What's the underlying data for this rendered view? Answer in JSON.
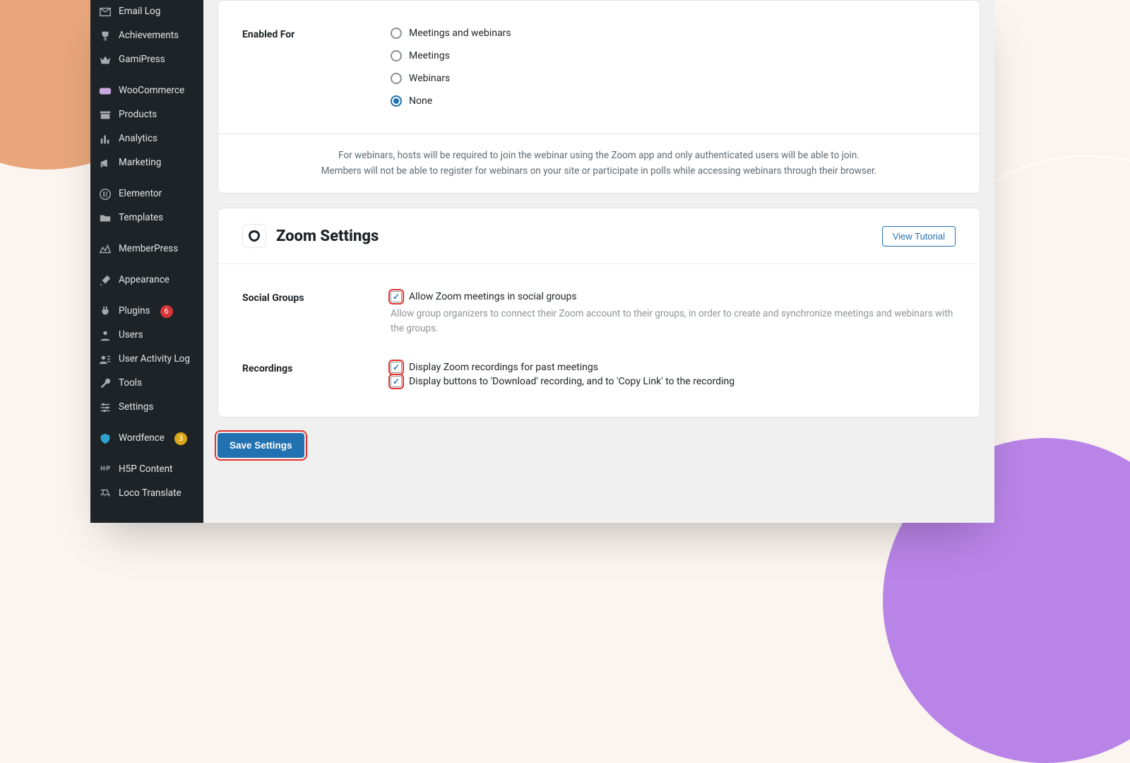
{
  "sidebar": {
    "items": [
      {
        "id": "email-log",
        "label": "Email Log"
      },
      {
        "id": "achievements",
        "label": "Achievements"
      },
      {
        "id": "gamipress",
        "label": "GamiPress"
      },
      {
        "id": "woocommerce",
        "label": "WooCommerce"
      },
      {
        "id": "products",
        "label": "Products"
      },
      {
        "id": "analytics",
        "label": "Analytics"
      },
      {
        "id": "marketing",
        "label": "Marketing"
      },
      {
        "id": "elementor",
        "label": "Elementor"
      },
      {
        "id": "templates",
        "label": "Templates"
      },
      {
        "id": "memberpress",
        "label": "MemberPress"
      },
      {
        "id": "appearance",
        "label": "Appearance"
      },
      {
        "id": "plugins",
        "label": "Plugins",
        "badge": "6",
        "badgeColor": "red"
      },
      {
        "id": "users",
        "label": "Users"
      },
      {
        "id": "user-activity-log",
        "label": "User Activity Log"
      },
      {
        "id": "tools",
        "label": "Tools"
      },
      {
        "id": "settings",
        "label": "Settings"
      },
      {
        "id": "wordfence",
        "label": "Wordfence",
        "badge": "3",
        "badgeColor": "orange"
      },
      {
        "id": "h5p-content",
        "label": "H5P Content"
      },
      {
        "id": "loco-translate",
        "label": "Loco Translate"
      }
    ]
  },
  "enabledFor": {
    "label": "Enabled For",
    "options": [
      {
        "id": "both",
        "label": "Meetings and webinars"
      },
      {
        "id": "meetings",
        "label": "Meetings"
      },
      {
        "id": "webinars",
        "label": "Webinars"
      },
      {
        "id": "none",
        "label": "None"
      }
    ],
    "selected": "none",
    "note": "For webinars, hosts will be required to join the webinar using the Zoom app and only authenticated users will be able to join.\nMembers will not be able to register for webinars on your site or participate in polls while accessing webinars through their browser."
  },
  "zoomSettings": {
    "title": "Zoom Settings",
    "tutorialLabel": "View Tutorial",
    "socialGroups": {
      "label": "Social Groups",
      "checkboxLabel": "Allow Zoom meetings in social groups",
      "checked": true,
      "description": "Allow group organizers to connect their Zoom account to their groups, in order to create and synchronize meetings and webinars with the groups."
    },
    "recordings": {
      "label": "Recordings",
      "opt1": {
        "label": "Display Zoom recordings for past meetings",
        "checked": true
      },
      "opt2": {
        "label": "Display buttons to 'Download' recording, and to 'Copy Link' to the recording",
        "checked": true
      }
    }
  },
  "saveLabel": "Save Settings"
}
